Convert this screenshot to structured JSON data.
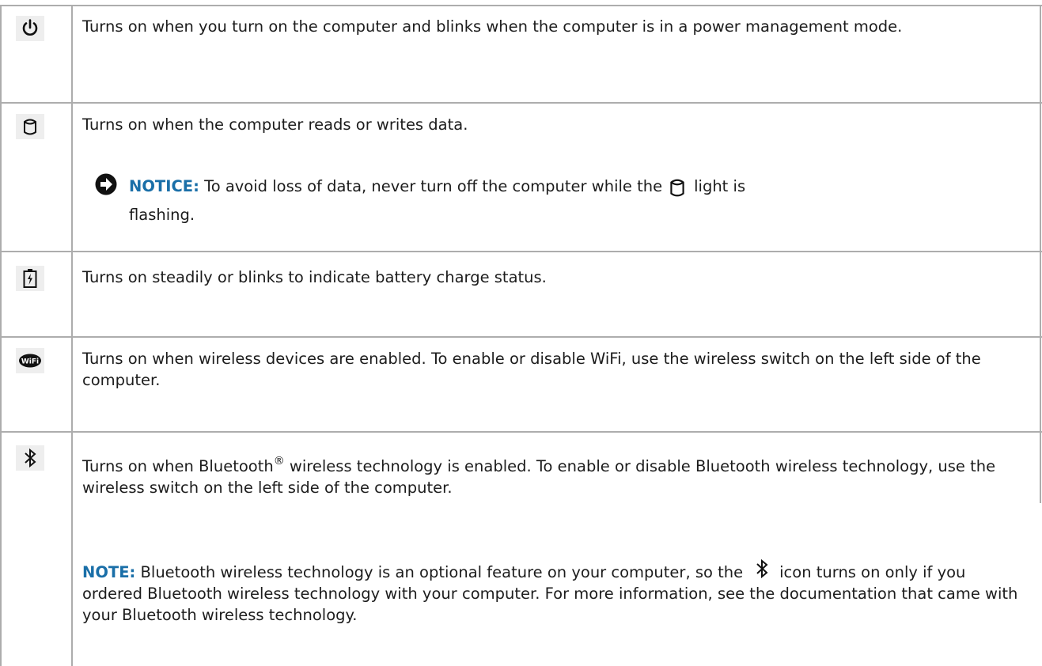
{
  "rows": [
    {
      "icon": "power-icon",
      "text": "Turns on when you turn on the computer and blinks when the computer is in a power management mode."
    },
    {
      "icon": "hard-drive-icon",
      "text": "Turns on when the computer reads or writes data.",
      "notice": {
        "label": "NOTICE:",
        "text_before": "To avoid loss of data, never turn off the computer while the",
        "inline_icon": "hard-drive-icon",
        "text_after": "light is",
        "text_continued": "flashing."
      }
    },
    {
      "icon": "battery-icon",
      "text": "Turns on steadily or blinks to indicate battery charge status."
    },
    {
      "icon": "wifi-icon",
      "text": "Turns on when wireless devices are enabled. To enable or disable WiFi, use the wireless switch on the left side of the computer."
    },
    {
      "icon": "bluetooth-icon",
      "text_before_mark": "Turns on when Bluetooth",
      "mark": "®",
      "text_after_mark": " wireless technology is enabled. To enable or disable Bluetooth wireless technology, use the wireless switch on the left side of the computer.",
      "note": {
        "label": "NOTE:",
        "text_before": "Bluetooth wireless technology is an optional feature on your computer, so the",
        "inline_icon": "bluetooth-icon",
        "text_after": "icon turns on only if you ordered Bluetooth wireless technology with your computer. For more information, see the documentation that came with your Bluetooth wireless technology."
      }
    }
  ],
  "colors": {
    "border": "#adadad",
    "label": "#1a6fa8",
    "text": "#1c1c1c"
  }
}
